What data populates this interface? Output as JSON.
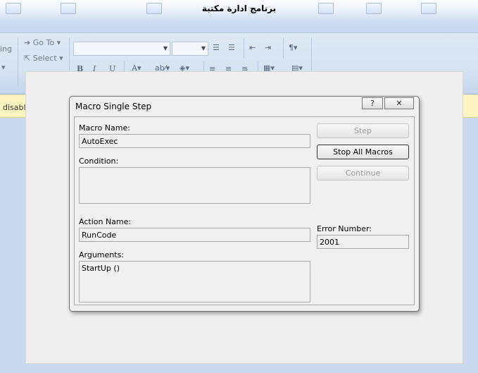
{
  "app": {
    "title": "برنامج ادارة مكتبة"
  },
  "ribbon": {
    "left_partial_label": "ing",
    "goto_label": "Go To",
    "select_label": "Select",
    "bold_glyph": "B",
    "italic_glyph": "I",
    "underline_glyph": "U",
    "font_color_glyph": "A",
    "paragraph_glyph": "¶"
  },
  "message_bar": {
    "text": "disabl"
  },
  "dialog": {
    "title": "Macro Single Step",
    "help_glyph": "?",
    "close_glyph": "✕",
    "macro_name_label": "Macro Name:",
    "macro_name_value": "AutoExec",
    "condition_label": "Condition:",
    "condition_value": "",
    "action_name_label": "Action Name:",
    "action_name_value": "RunCode",
    "arguments_label": "Arguments:",
    "arguments_value": "StartUp ()",
    "error_number_label": "Error Number:",
    "error_number_value": "2001",
    "step_label": "Step",
    "stop_all_label": "Stop All Macros",
    "continue_label": "Continue"
  },
  "icons": {
    "help": "question-icon",
    "close": "close-icon",
    "goto": "arrow-right-icon",
    "select": "cursor-icon"
  }
}
